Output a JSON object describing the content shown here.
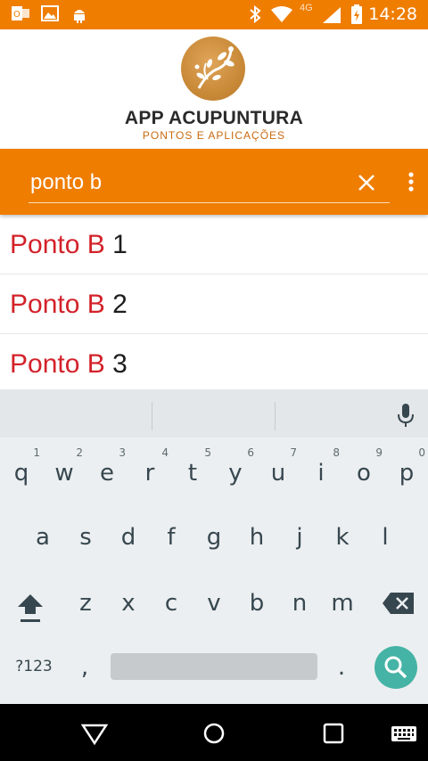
{
  "status_bar": {
    "time": "14:28",
    "network": "4G",
    "icons": [
      "outlook-icon",
      "image-icon",
      "android-icon",
      "bluetooth-icon",
      "wifi-icon",
      "signal-icon",
      "battery-icon"
    ]
  },
  "brand": {
    "title": "APP ACUPUNTURA",
    "subtitle": "PONTOS E APLICAÇÕES"
  },
  "search": {
    "value": "ponto b"
  },
  "results": [
    {
      "match": "Ponto B",
      "rest": " 1"
    },
    {
      "match": "Ponto B",
      "rest": " 2"
    },
    {
      "match": "Ponto B",
      "rest": " 3"
    }
  ],
  "keyboard": {
    "row1": [
      "q",
      "w",
      "e",
      "r",
      "t",
      "y",
      "u",
      "i",
      "o",
      "p"
    ],
    "row1_hints": [
      "1",
      "2",
      "3",
      "4",
      "5",
      "6",
      "7",
      "8",
      "9",
      "0"
    ],
    "row2": [
      "a",
      "s",
      "d",
      "f",
      "g",
      "h",
      "j",
      "k",
      "l"
    ],
    "row3": [
      "z",
      "x",
      "c",
      "v",
      "b",
      "n",
      "m"
    ],
    "symbols_label": "?123",
    "comma": ",",
    "period": "."
  },
  "colors": {
    "accent": "#ef7d00",
    "match": "#d3222a",
    "search_key": "#45b3a5"
  }
}
